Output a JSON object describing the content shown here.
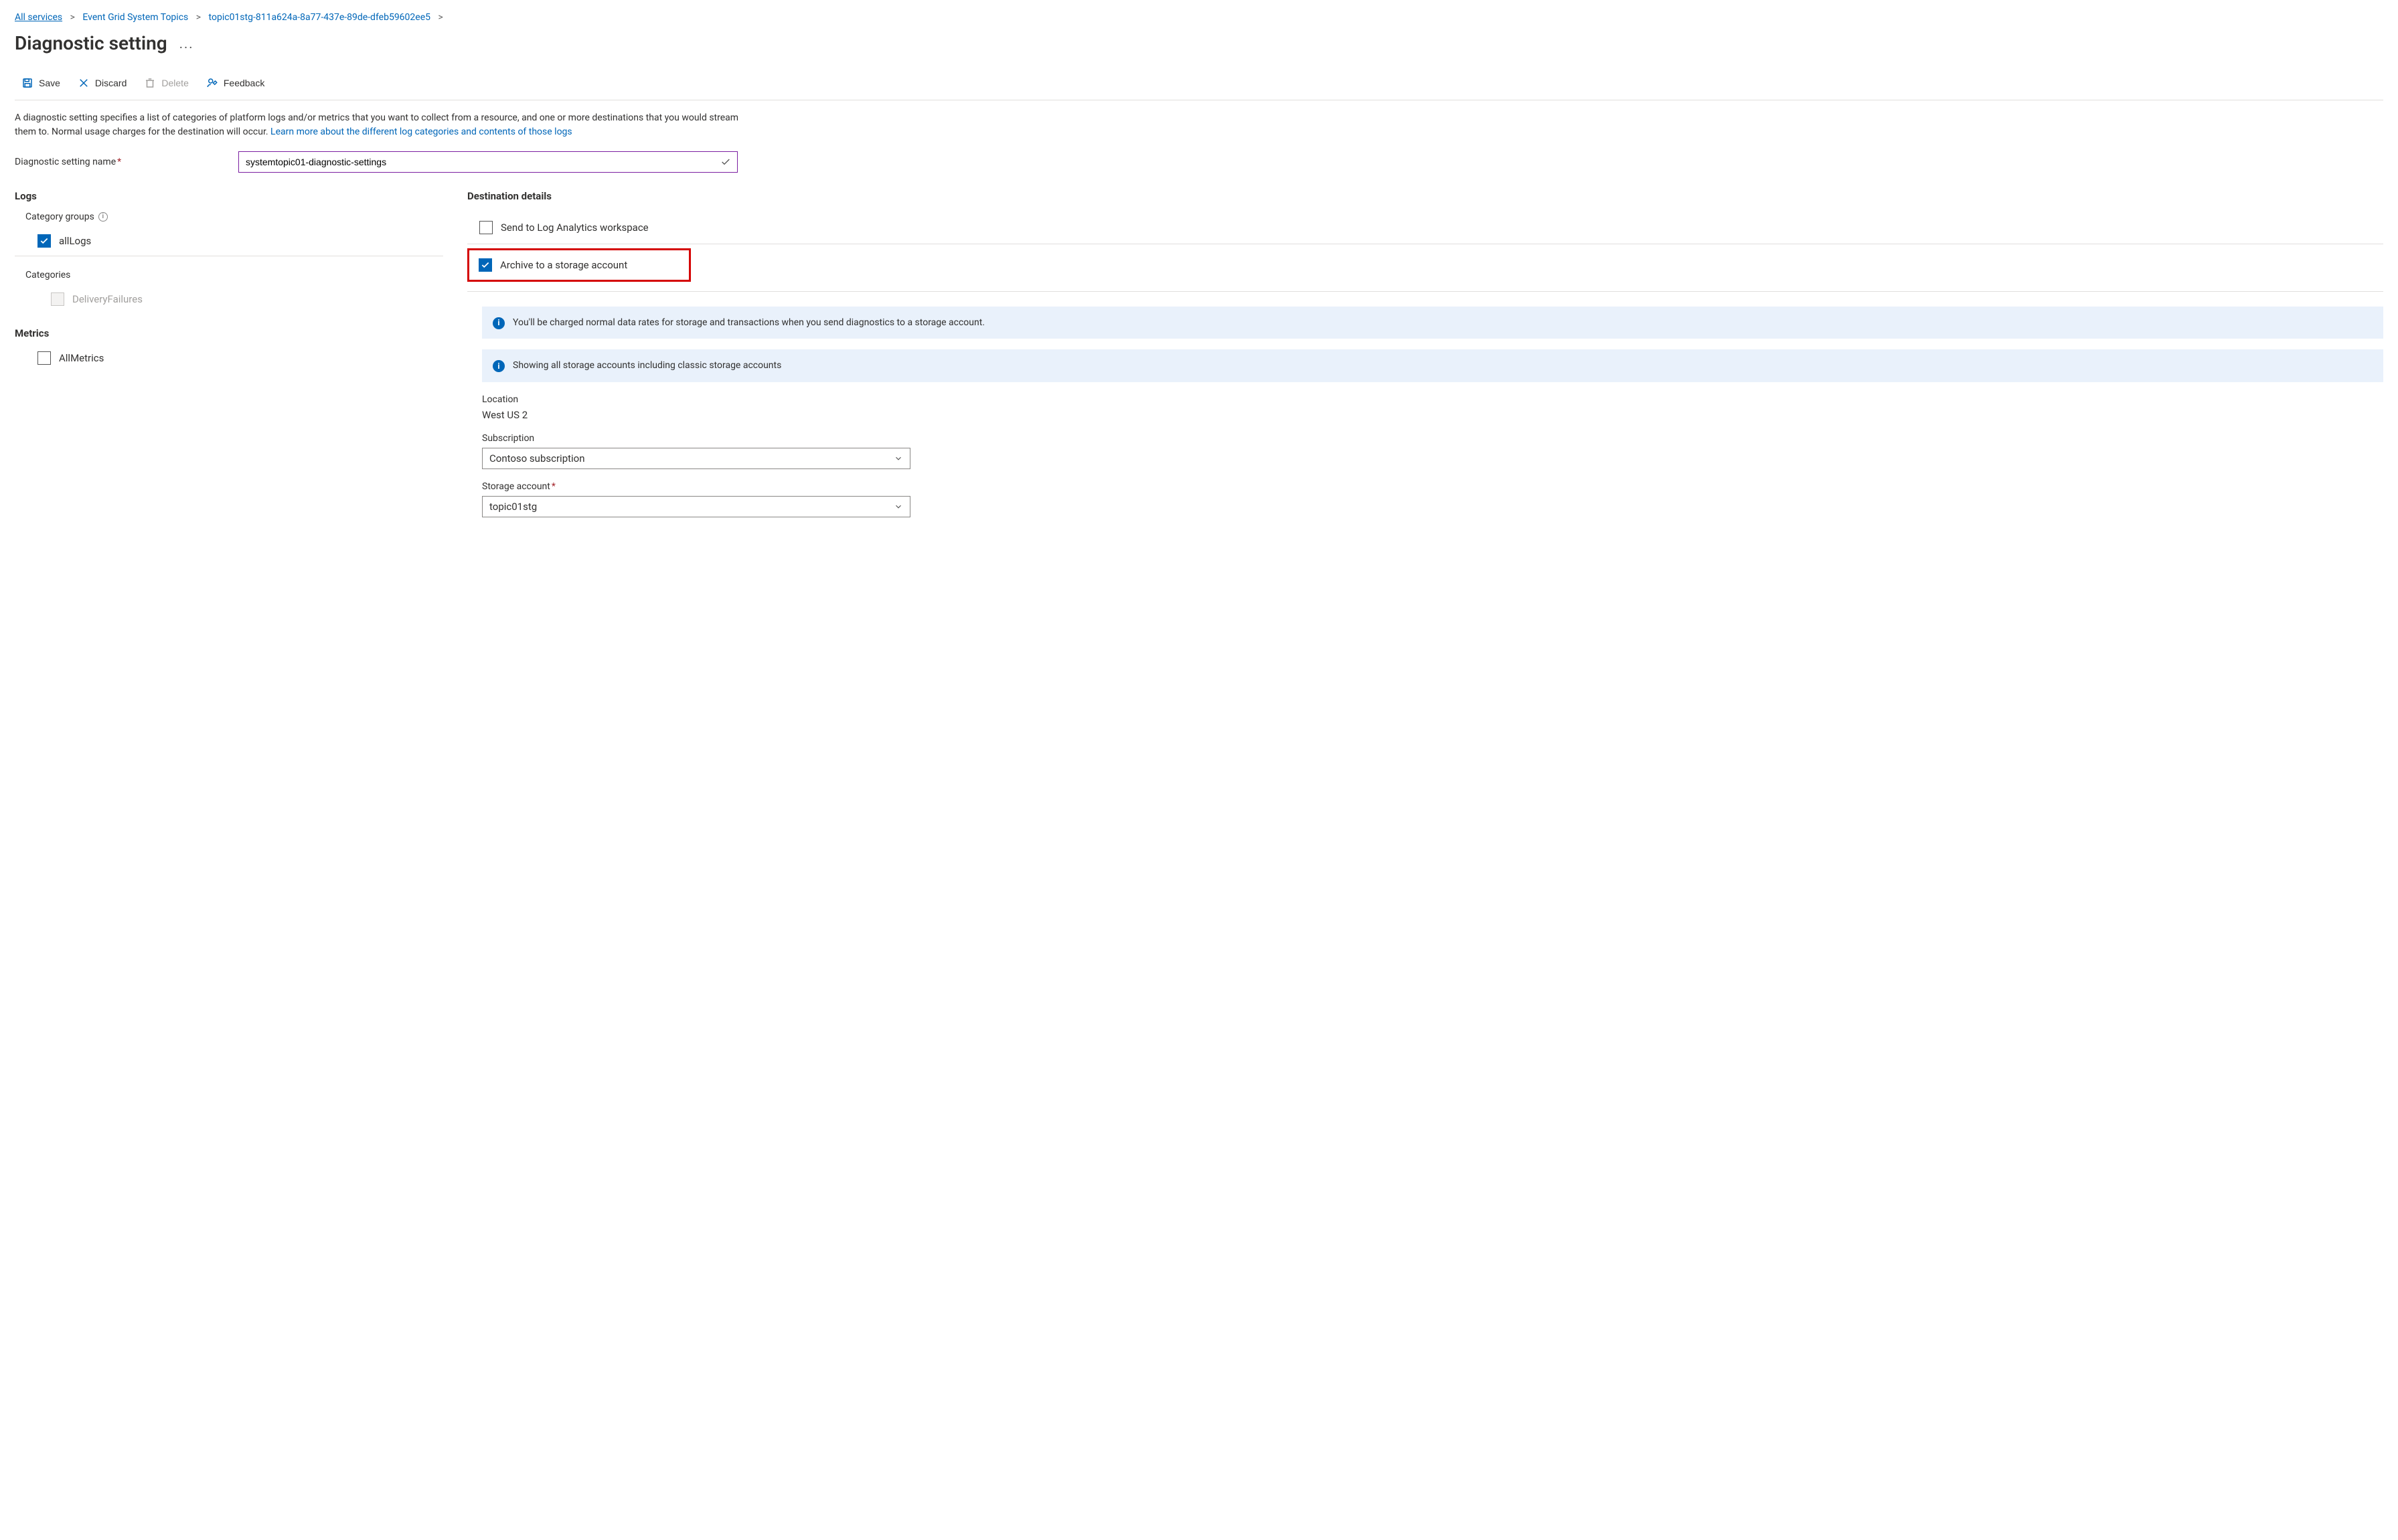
{
  "breadcrumb": {
    "items": [
      "All services",
      "Event Grid System Topics",
      "topic01stg-811a624a-8a77-437e-89de-dfeb59602ee5"
    ]
  },
  "page": {
    "title": "Diagnostic setting",
    "more": "..."
  },
  "toolbar": {
    "save": "Save",
    "discard": "Discard",
    "delete": "Delete",
    "feedback": "Feedback"
  },
  "description": {
    "text_a": "A diagnostic setting specifies a list of categories of platform logs and/or metrics that you want to collect from a resource, and one or more destinations that you would stream them to. Normal usage charges for the destination will occur. ",
    "link": "Learn more about the different log categories and contents of those logs"
  },
  "name_field": {
    "label": "Diagnostic setting name",
    "value": "systemtopic01-diagnostic-settings"
  },
  "logs": {
    "heading": "Logs",
    "category_groups_label": "Category groups",
    "all_logs": {
      "label": "allLogs",
      "checked": true
    },
    "categories_label": "Categories",
    "delivery_failures": {
      "label": "DeliveryFailures",
      "checked": false
    }
  },
  "metrics": {
    "heading": "Metrics",
    "all_metrics": {
      "label": "AllMetrics",
      "checked": false
    }
  },
  "destination": {
    "heading": "Destination details",
    "log_analytics": {
      "label": "Send to Log Analytics workspace",
      "checked": false
    },
    "storage": {
      "label": "Archive to a storage account",
      "checked": true
    },
    "info1": "You'll be charged normal data rates for storage and transactions when you send diagnostics to a storage account.",
    "info2": "Showing all storage accounts including classic storage accounts",
    "location_label": "Location",
    "location_value": "West US 2",
    "subscription_label": "Subscription",
    "subscription_value": "Contoso subscription",
    "storage_account_label": "Storage account",
    "storage_account_value": "topic01stg"
  }
}
